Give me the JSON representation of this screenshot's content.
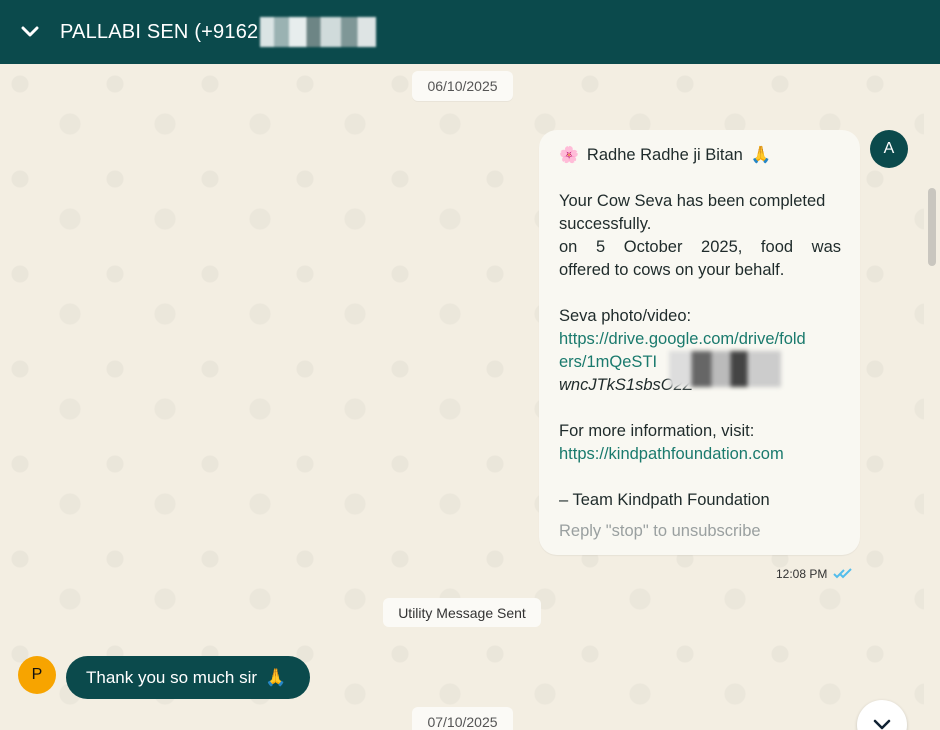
{
  "header": {
    "title": "PALLABI SEN (+9162"
  },
  "chat": {
    "date1": "06/10/2025",
    "date2": "07/10/2025",
    "utility_label": "Utility Message Sent",
    "avatar_a": "A",
    "avatar_p": "P",
    "outgoing": {
      "greeting": "Radhe Radhe ji Bitan",
      "line1": "Your Cow Seva has been completed",
      "line2": "successfully.",
      "line3": "on 5 October 2025, food was",
      "line4": "offered to cows on your behalf.",
      "line5": "Seva photo/video:",
      "link1": "https://drive.google.com/drive/fold",
      "link2": "ers/1mQeSTI",
      "link3": "wncJTkS1sbsO2Z",
      "line6": "For more information, visit:",
      "link4": "https://kindpathfoundation.com",
      "line7": "– Team Kindpath Foundation",
      "unsubscribe": "Reply \"stop\" to unsubscribe",
      "time": "12:08 PM"
    },
    "incoming": {
      "text": "Thank you so much sir"
    }
  },
  "colors": {
    "header": "#0b4a4c",
    "background": "#f3eee2",
    "link": "#1a7a6d",
    "read_tick": "#53bdeb"
  }
}
